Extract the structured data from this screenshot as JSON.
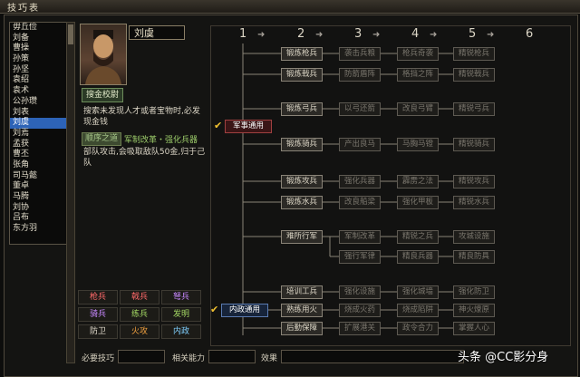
{
  "window": {
    "title": "技巧表"
  },
  "characters": [
    "毋丘俭",
    "刘备",
    "曹操",
    "孙策",
    "孙坚",
    "袁绍",
    "袁术",
    "公孙瓒",
    "刘表",
    "刘虞",
    "刘焉",
    "孟获",
    "曹丕",
    "张角",
    "司马懿",
    "董卓",
    "马腾",
    "刘协",
    "吕布",
    "东方羽"
  ],
  "selected_character": "刘虞",
  "info": {
    "name": "刘虞",
    "rank_badge": "搜金校尉",
    "desc1": "搜索未发现人才或者宝物时,必发现金钱",
    "skill_badge": "顺序之道",
    "skill_name": "军制改革・强化兵器",
    "desc2": "部队攻击,会吸取敌队50金,归于己队"
  },
  "categories": [
    {
      "label": "枪兵",
      "color": "#ff6a6a"
    },
    {
      "label": "戟兵",
      "color": "#ff6a6a"
    },
    {
      "label": "弩兵",
      "color": "#c888ff"
    },
    {
      "label": "骑兵",
      "color": "#c888ff"
    },
    {
      "label": "练兵",
      "color": "#a4d864"
    },
    {
      "label": "发明",
      "color": "#a4d864"
    },
    {
      "label": "防卫",
      "color": "#e0dacb"
    },
    {
      "label": "火攻",
      "color": "#f0a040"
    },
    {
      "label": "内政",
      "color": "#80d0ff"
    }
  ],
  "bottom": {
    "req_label": "必要技巧",
    "rel_label": "相关能力",
    "eff_label": "效果"
  },
  "columns": [
    "1",
    "2",
    "3",
    "4",
    "5",
    "6"
  ],
  "tree": {
    "root_military": "军事通用",
    "root_domestic": "内政通用",
    "military": [
      [
        "锻炼枪兵",
        "袭击兵粮",
        "枪兵奇袭",
        "精锐枪兵"
      ],
      [
        "锻炼戟兵",
        "防箭盾阵",
        "格挡之阵",
        "精锐戟兵"
      ],
      [
        "锻炼弓兵",
        "以弓还箭",
        "改良弓臂",
        "精锐弓兵"
      ],
      [
        "锻炼骑兵",
        "产出良马",
        "马胸马镫",
        "精锐骑兵"
      ],
      [
        "锻炼攻兵",
        "强化兵器",
        "霹雳之法",
        "精锐攻兵"
      ],
      [
        "锻炼水兵",
        "改良船梁",
        "强化甲板",
        "精锐水兵"
      ]
    ],
    "march": [
      "难所行军",
      "军制改革",
      "精锐之兵",
      "攻城设施"
    ],
    "march2": [
      "强行军律",
      "精良兵器",
      "精良防具"
    ],
    "domestic": [
      [
        "培训工兵",
        "强化设施",
        "强化城墙",
        "强化防卫"
      ],
      [
        "熟练用火",
        "烧成火药",
        "烧成陷阱",
        "神火燎原"
      ],
      [
        "后勤保障",
        "扩展港关",
        "政令合力",
        "掌握人心"
      ]
    ]
  },
  "watermark": "头条 @CC影分身"
}
